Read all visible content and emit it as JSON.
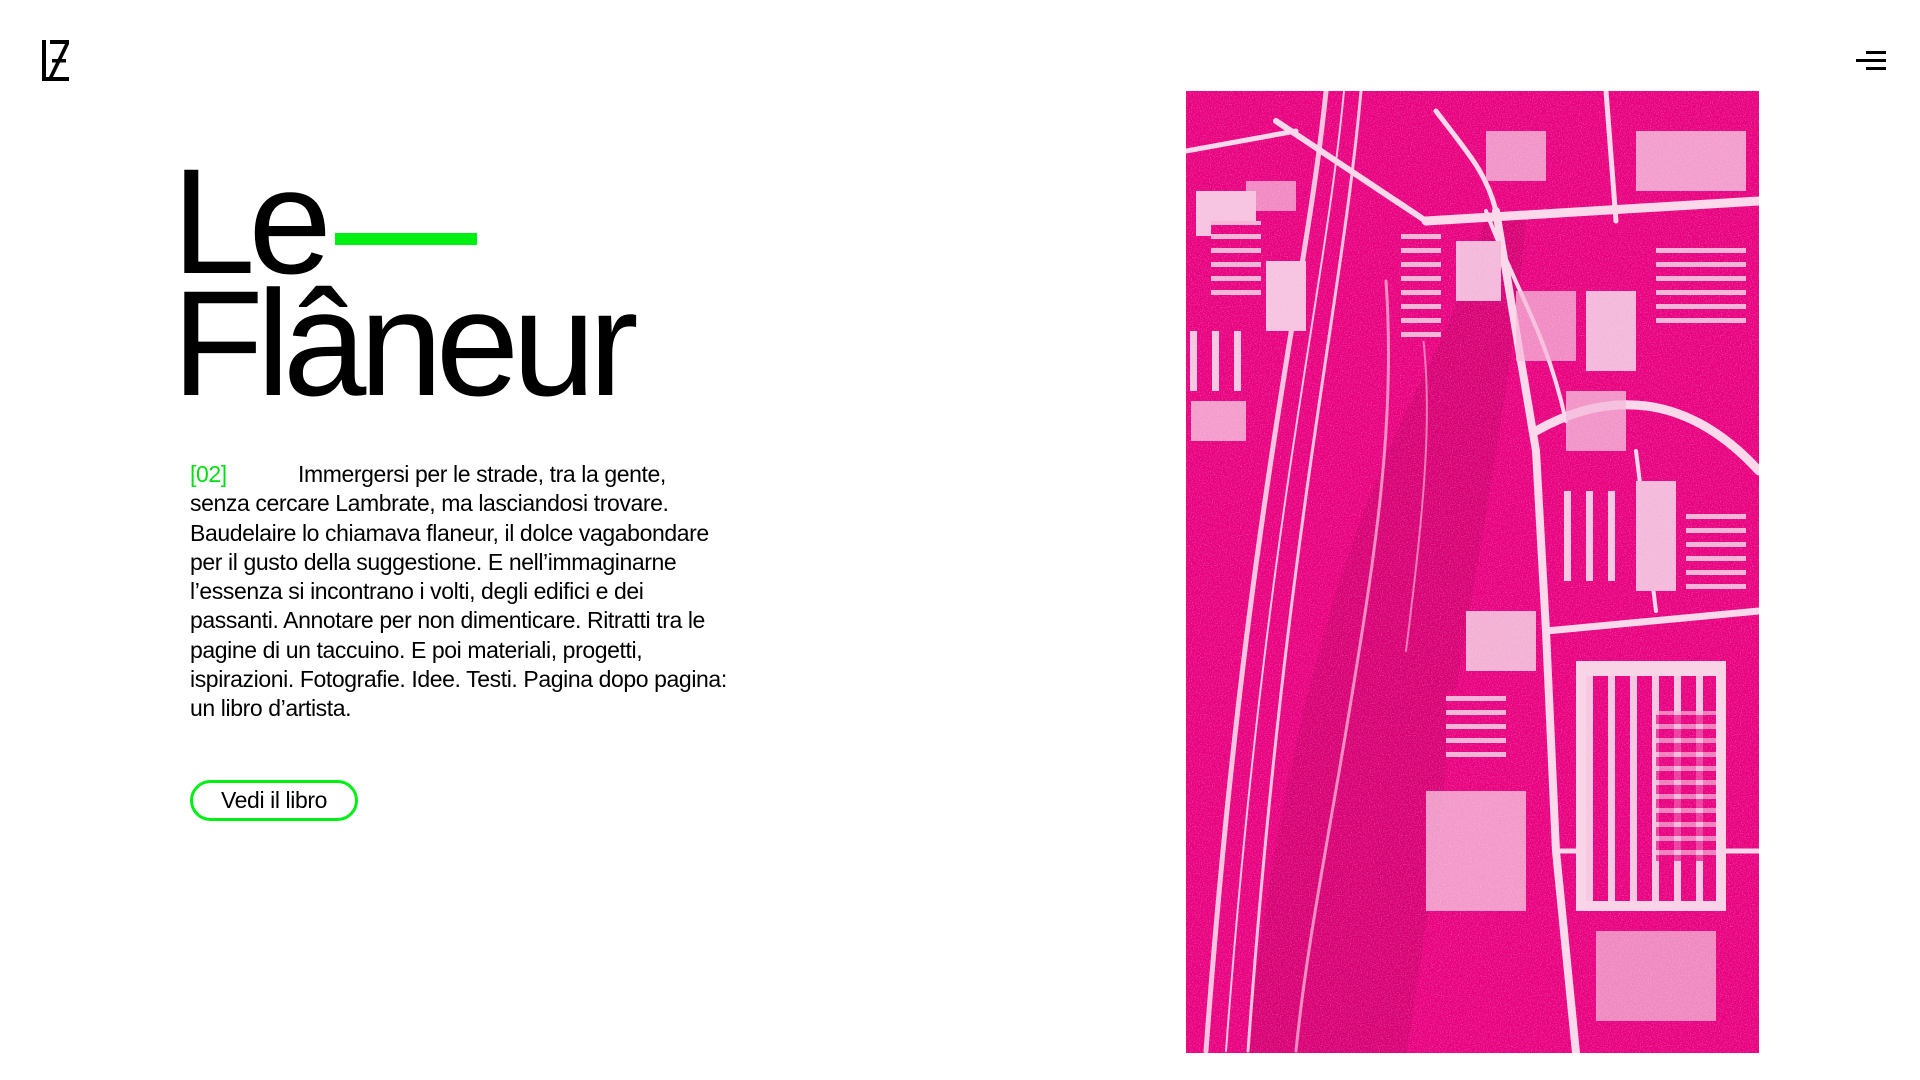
{
  "header": {
    "logo_icon": "lz-monogram-icon",
    "menu_icon": "hamburger-menu-icon"
  },
  "hero": {
    "title_line1": "Le",
    "title_line2": "Flâneur",
    "section_number": "[02]",
    "description": "Immergersi per le strade, tra la gente, senza cercare Lambrate, ma lasciandosi trovare. Baudelaire lo chiamava flaneur, il dolce vagabondare per il gusto della suggestione. E nell’immaginarne l’essenza si incontrano i volti, degli edifici e dei passanti. Annotare per non dimenticare. Ritratti tra le pagine di un taccuino. E poi materiali, progetti, ispirazioni. Fotografie. Idee. Testi. Pagina dopo pagina: un libro d’artista.",
    "cta_label": "Vedi il libro"
  },
  "colors": {
    "accent": "#00f014",
    "photo_tint": "#e8007f",
    "text": "#000000",
    "background": "#ffffff"
  }
}
